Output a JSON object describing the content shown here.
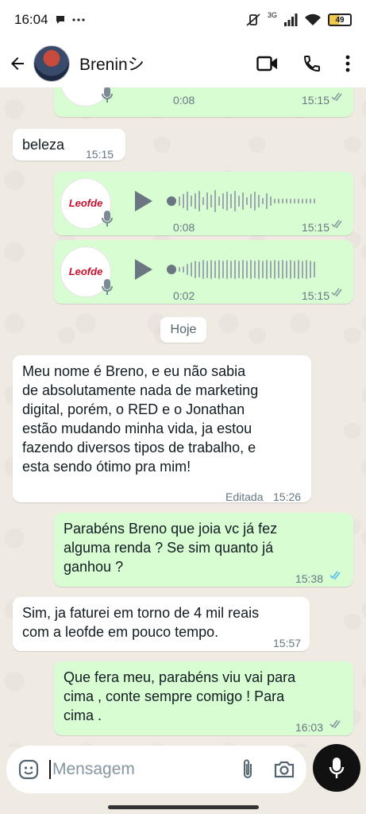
{
  "status_bar": {
    "time": "16:04",
    "left_icons": [
      "chat-bubble-icon",
      "more-dots-icon"
    ],
    "network": "3G",
    "battery": "49"
  },
  "header": {
    "contact_name": "Breninシ",
    "actions": [
      "video-call-icon",
      "phone-icon",
      "menu-icon"
    ]
  },
  "messages": [
    {
      "type": "audio",
      "direction": "out",
      "duration": "0:08",
      "time": "15:15",
      "status": "read-grey",
      "partial": true
    },
    {
      "type": "text",
      "direction": "in",
      "text": "beleza",
      "time": "15:15"
    },
    {
      "type": "audio",
      "direction": "out",
      "logo": "Leofde",
      "duration": "0:08",
      "time": "15:15",
      "status": "read-grey"
    },
    {
      "type": "audio",
      "direction": "out",
      "logo": "Leofde",
      "duration": "0:02",
      "time": "15:15",
      "status": "read-grey"
    },
    {
      "type": "day",
      "text": "Hoje"
    },
    {
      "type": "text",
      "direction": "in",
      "lines": [
        "Meu nome é Breno, e eu não sabia",
        "de absolutamente nada de marketing",
        "digital, porém, o RED e o Jonathan",
        "estão mudando minha vida, ja estou",
        "fazendo diversos tipos de trabalho, e",
        "esta sendo ótimo pra mim!"
      ],
      "edited": "Editada",
      "time": "15:26"
    },
    {
      "type": "text",
      "direction": "out",
      "lines": [
        "Parabéns Breno que joia vc já fez",
        "alguma renda ? Se sim quanto já",
        "ganhou ?"
      ],
      "time": "15:38",
      "status": "read-blue"
    },
    {
      "type": "text",
      "direction": "in",
      "lines": [
        "Sim, ja faturei em torno de 4 mil reais",
        "com a leofde em pouco tempo."
      ],
      "time": "15:57"
    },
    {
      "type": "text",
      "direction": "out",
      "lines": [
        "Que fera meu, parabéns viu vai para",
        "cima , conte sempre comigo ! Para",
        "cima ."
      ],
      "time": "16:03",
      "status": "read-grey"
    }
  ],
  "input": {
    "placeholder": "Mensagem"
  },
  "colors": {
    "outgoing_bubble": "#d9fdd3",
    "incoming_bubble": "#ffffff",
    "chat_background": "#efeae2",
    "read_tick_blue": "#53bdeb"
  }
}
